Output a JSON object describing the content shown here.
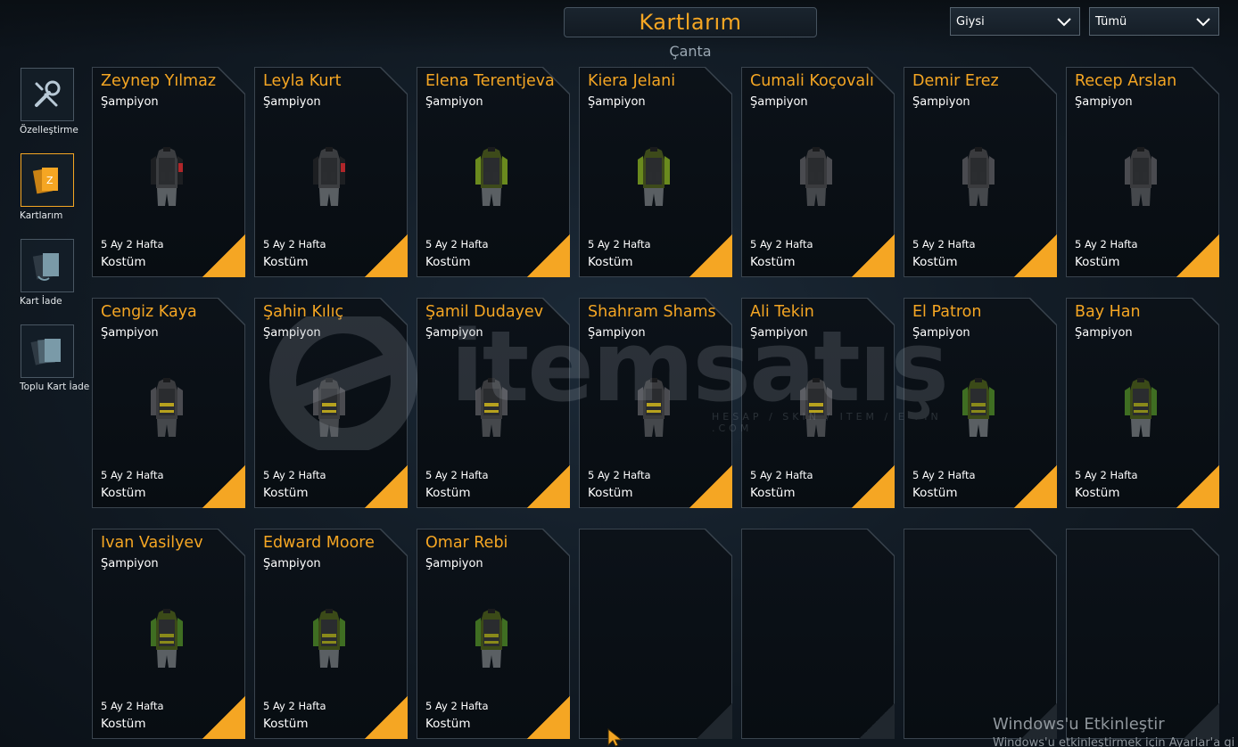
{
  "header": {
    "title": "Kartlarım",
    "subtitle": "Çanta"
  },
  "filters": {
    "category": "Giysi",
    "scope": "Tümü"
  },
  "sidebar": [
    {
      "label": "Özelleştirme",
      "icon": "tools-icon",
      "active": false
    },
    {
      "label": "Kartlarım",
      "icon": "cards-icon",
      "active": true
    },
    {
      "label": "Kart İade",
      "icon": "card-return-icon",
      "active": false
    },
    {
      "label": "Toplu Kart İade",
      "icon": "bulk-card-return-icon",
      "active": false
    }
  ],
  "cards": [
    {
      "name": "Zeynep Yılmaz",
      "rank": "Şampiyon",
      "duration": "5 Ay 2 Hafta",
      "type": "Kostüm",
      "outfit": "dark-red-armband"
    },
    {
      "name": "Leyla Kurt",
      "rank": "Şampiyon",
      "duration": "5 Ay 2 Hafta",
      "type": "Kostüm",
      "outfit": "dark-red-armband"
    },
    {
      "name": "Elena Terentjeva",
      "rank": "Şampiyon",
      "duration": "5 Ay 2 Hafta",
      "type": "Kostüm",
      "outfit": "olive-sleeves"
    },
    {
      "name": "Kiera Jelani",
      "rank": "Şampiyon",
      "duration": "5 Ay 2 Hafta",
      "type": "Kostüm",
      "outfit": "olive-sleeves"
    },
    {
      "name": "Cumali Koçovalı",
      "rank": "Şampiyon",
      "duration": "5 Ay 2 Hafta",
      "type": "Kostüm",
      "outfit": "grey"
    },
    {
      "name": "Demir Erez",
      "rank": "Şampiyon",
      "duration": "5 Ay 2 Hafta",
      "type": "Kostüm",
      "outfit": "grey"
    },
    {
      "name": "Recep Arslan",
      "rank": "Şampiyon",
      "duration": "5 Ay 2 Hafta",
      "type": "Kostüm",
      "outfit": "grey"
    },
    {
      "name": "Cengiz Kaya",
      "rank": "Şampiyon",
      "duration": "5 Ay 2 Hafta",
      "type": "Kostüm",
      "outfit": "grey-yellow"
    },
    {
      "name": "Şahin Kılıç",
      "rank": "Şampiyon",
      "duration": "5 Ay 2 Hafta",
      "type": "Kostüm",
      "outfit": "grey-yellow"
    },
    {
      "name": "Şamil Dudayev",
      "rank": "Şampiyon",
      "duration": "5 Ay 2 Hafta",
      "type": "Kostüm",
      "outfit": "grey-yellow"
    },
    {
      "name": "Shahram Shams",
      "rank": "Şampiyon",
      "duration": "5 Ay 2 Hafta",
      "type": "Kostüm",
      "outfit": "grey-yellow"
    },
    {
      "name": "Ali Tekin",
      "rank": "Şampiyon",
      "duration": "5 Ay 2 Hafta",
      "type": "Kostüm",
      "outfit": "grey-yellow"
    },
    {
      "name": "El Patron",
      "rank": "Şampiyon",
      "duration": "5 Ay 2 Hafta",
      "type": "Kostüm",
      "outfit": "green-sleeves"
    },
    {
      "name": "Bay Han",
      "rank": "Şampiyon",
      "duration": "5 Ay 2 Hafta",
      "type": "Kostüm",
      "outfit": "green-sleeves"
    },
    {
      "name": "Ivan Vasilyev",
      "rank": "Şampiyon",
      "duration": "5 Ay 2 Hafta",
      "type": "Kostüm",
      "outfit": "green-sleeves"
    },
    {
      "name": "Edward Moore",
      "rank": "Şampiyon",
      "duration": "5 Ay 2 Hafta",
      "type": "Kostüm",
      "outfit": "green-sleeves"
    },
    {
      "name": "Omar Rebi",
      "rank": "Şampiyon",
      "duration": "5 Ay 2 Hafta",
      "type": "Kostüm",
      "outfit": "green-sleeves"
    }
  ],
  "empty_slots": 4,
  "watermark": {
    "text": "itemsatış",
    "sub": "HESAP / SKIN / ITEM / E-PIN .COM"
  },
  "windows_notice": {
    "title": "Windows'u Etkinleştir",
    "sub": "Windows'u etkinleştirmek için Ayarlar'a gi"
  },
  "colors": {
    "accent": "#f5a623",
    "card_bg": "#0a1016",
    "card_border": "#3a444e",
    "background": "#141e28"
  }
}
